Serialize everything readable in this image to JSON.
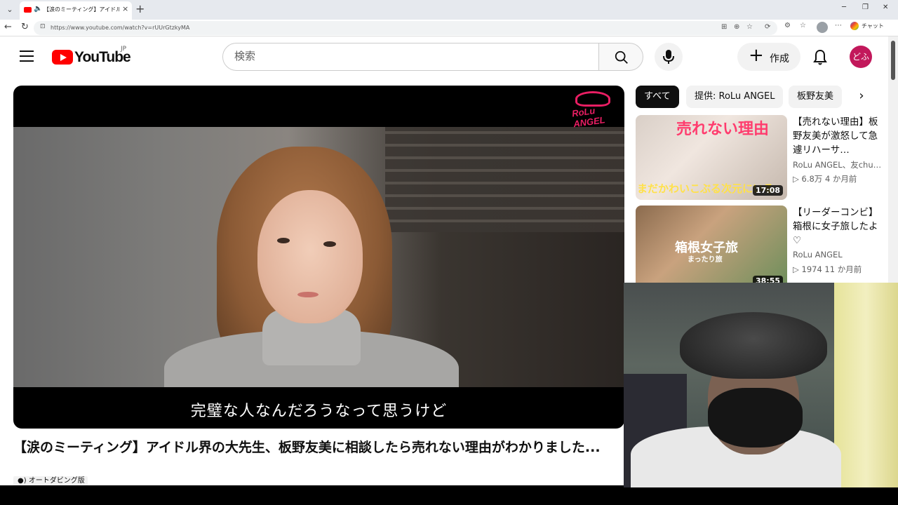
{
  "browser": {
    "tab_title": "【涙のミーティング】アイドル界の大先生",
    "url": "https://www.youtube.com/watch?v=rUUrGtzkyMA",
    "chat_label": "チャット",
    "new_tab": "+",
    "tab_close": "×"
  },
  "header": {
    "logo_text": "YouTube",
    "country_code": "JP",
    "search_placeholder": "検索",
    "create_label": "作成",
    "avatar_text": "どふ"
  },
  "player": {
    "channel_badge": "RoLu ANGEL",
    "subtitle": "完璧な人なんだろうなって思うけど"
  },
  "video": {
    "title": "【涙のミーティング】アイドル界の大先生、板野友美に相談したら売れない理由がわかりました...",
    "dub_label": "オートダビング版"
  },
  "chips": [
    {
      "label": "すべて"
    },
    {
      "label": "提供: RoLu ANGEL"
    },
    {
      "label": "板野友美"
    }
  ],
  "recommendations": [
    {
      "title": "【売れない理由】板野友美が激怒して急遽リハーサ…",
      "channel": "RoLu ANGEL、友chu…",
      "meta": "▷ 6.8万  4 か月前",
      "duration": "17:08",
      "thumb_text_top": "売れない理由",
      "thumb_text_bottom": "まだかわいこぶる次元にいる"
    },
    {
      "title": "【リーダーコンビ】箱根に女子旅したよ♡",
      "channel": "RoLu ANGEL",
      "meta": "▷ 1974  11 か月前",
      "duration": "38:55",
      "thumb_text_top": "箱根女子旅",
      "thumb_text_bottom": "まったり旅"
    }
  ],
  "colors": {
    "accent": "#ff0000",
    "avatar_bg": "#c2185b",
    "badge": "#e91e63"
  }
}
